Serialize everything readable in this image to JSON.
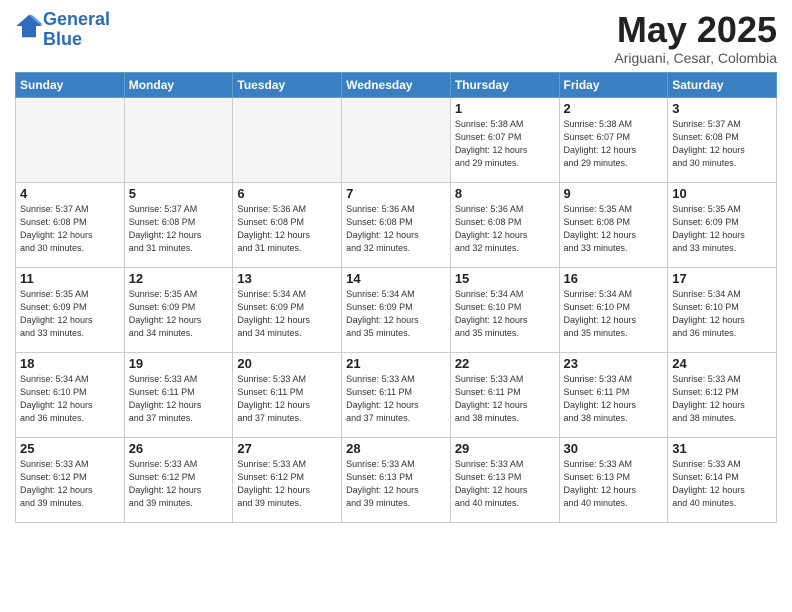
{
  "header": {
    "logo_line1": "General",
    "logo_line2": "Blue",
    "month": "May 2025",
    "location": "Ariguani, Cesar, Colombia"
  },
  "weekdays": [
    "Sunday",
    "Monday",
    "Tuesday",
    "Wednesday",
    "Thursday",
    "Friday",
    "Saturday"
  ],
  "weeks": [
    [
      {
        "day": "",
        "info": ""
      },
      {
        "day": "",
        "info": ""
      },
      {
        "day": "",
        "info": ""
      },
      {
        "day": "",
        "info": ""
      },
      {
        "day": "1",
        "info": "Sunrise: 5:38 AM\nSunset: 6:07 PM\nDaylight: 12 hours\nand 29 minutes."
      },
      {
        "day": "2",
        "info": "Sunrise: 5:38 AM\nSunset: 6:07 PM\nDaylight: 12 hours\nand 29 minutes."
      },
      {
        "day": "3",
        "info": "Sunrise: 5:37 AM\nSunset: 6:08 PM\nDaylight: 12 hours\nand 30 minutes."
      }
    ],
    [
      {
        "day": "4",
        "info": "Sunrise: 5:37 AM\nSunset: 6:08 PM\nDaylight: 12 hours\nand 30 minutes."
      },
      {
        "day": "5",
        "info": "Sunrise: 5:37 AM\nSunset: 6:08 PM\nDaylight: 12 hours\nand 31 minutes."
      },
      {
        "day": "6",
        "info": "Sunrise: 5:36 AM\nSunset: 6:08 PM\nDaylight: 12 hours\nand 31 minutes."
      },
      {
        "day": "7",
        "info": "Sunrise: 5:36 AM\nSunset: 6:08 PM\nDaylight: 12 hours\nand 32 minutes."
      },
      {
        "day": "8",
        "info": "Sunrise: 5:36 AM\nSunset: 6:08 PM\nDaylight: 12 hours\nand 32 minutes."
      },
      {
        "day": "9",
        "info": "Sunrise: 5:35 AM\nSunset: 6:08 PM\nDaylight: 12 hours\nand 33 minutes."
      },
      {
        "day": "10",
        "info": "Sunrise: 5:35 AM\nSunset: 6:09 PM\nDaylight: 12 hours\nand 33 minutes."
      }
    ],
    [
      {
        "day": "11",
        "info": "Sunrise: 5:35 AM\nSunset: 6:09 PM\nDaylight: 12 hours\nand 33 minutes."
      },
      {
        "day": "12",
        "info": "Sunrise: 5:35 AM\nSunset: 6:09 PM\nDaylight: 12 hours\nand 34 minutes."
      },
      {
        "day": "13",
        "info": "Sunrise: 5:34 AM\nSunset: 6:09 PM\nDaylight: 12 hours\nand 34 minutes."
      },
      {
        "day": "14",
        "info": "Sunrise: 5:34 AM\nSunset: 6:09 PM\nDaylight: 12 hours\nand 35 minutes."
      },
      {
        "day": "15",
        "info": "Sunrise: 5:34 AM\nSunset: 6:10 PM\nDaylight: 12 hours\nand 35 minutes."
      },
      {
        "day": "16",
        "info": "Sunrise: 5:34 AM\nSunset: 6:10 PM\nDaylight: 12 hours\nand 35 minutes."
      },
      {
        "day": "17",
        "info": "Sunrise: 5:34 AM\nSunset: 6:10 PM\nDaylight: 12 hours\nand 36 minutes."
      }
    ],
    [
      {
        "day": "18",
        "info": "Sunrise: 5:34 AM\nSunset: 6:10 PM\nDaylight: 12 hours\nand 36 minutes."
      },
      {
        "day": "19",
        "info": "Sunrise: 5:33 AM\nSunset: 6:11 PM\nDaylight: 12 hours\nand 37 minutes."
      },
      {
        "day": "20",
        "info": "Sunrise: 5:33 AM\nSunset: 6:11 PM\nDaylight: 12 hours\nand 37 minutes."
      },
      {
        "day": "21",
        "info": "Sunrise: 5:33 AM\nSunset: 6:11 PM\nDaylight: 12 hours\nand 37 minutes."
      },
      {
        "day": "22",
        "info": "Sunrise: 5:33 AM\nSunset: 6:11 PM\nDaylight: 12 hours\nand 38 minutes."
      },
      {
        "day": "23",
        "info": "Sunrise: 5:33 AM\nSunset: 6:11 PM\nDaylight: 12 hours\nand 38 minutes."
      },
      {
        "day": "24",
        "info": "Sunrise: 5:33 AM\nSunset: 6:12 PM\nDaylight: 12 hours\nand 38 minutes."
      }
    ],
    [
      {
        "day": "25",
        "info": "Sunrise: 5:33 AM\nSunset: 6:12 PM\nDaylight: 12 hours\nand 39 minutes."
      },
      {
        "day": "26",
        "info": "Sunrise: 5:33 AM\nSunset: 6:12 PM\nDaylight: 12 hours\nand 39 minutes."
      },
      {
        "day": "27",
        "info": "Sunrise: 5:33 AM\nSunset: 6:12 PM\nDaylight: 12 hours\nand 39 minutes."
      },
      {
        "day": "28",
        "info": "Sunrise: 5:33 AM\nSunset: 6:13 PM\nDaylight: 12 hours\nand 39 minutes."
      },
      {
        "day": "29",
        "info": "Sunrise: 5:33 AM\nSunset: 6:13 PM\nDaylight: 12 hours\nand 40 minutes."
      },
      {
        "day": "30",
        "info": "Sunrise: 5:33 AM\nSunset: 6:13 PM\nDaylight: 12 hours\nand 40 minutes."
      },
      {
        "day": "31",
        "info": "Sunrise: 5:33 AM\nSunset: 6:14 PM\nDaylight: 12 hours\nand 40 minutes."
      }
    ]
  ]
}
